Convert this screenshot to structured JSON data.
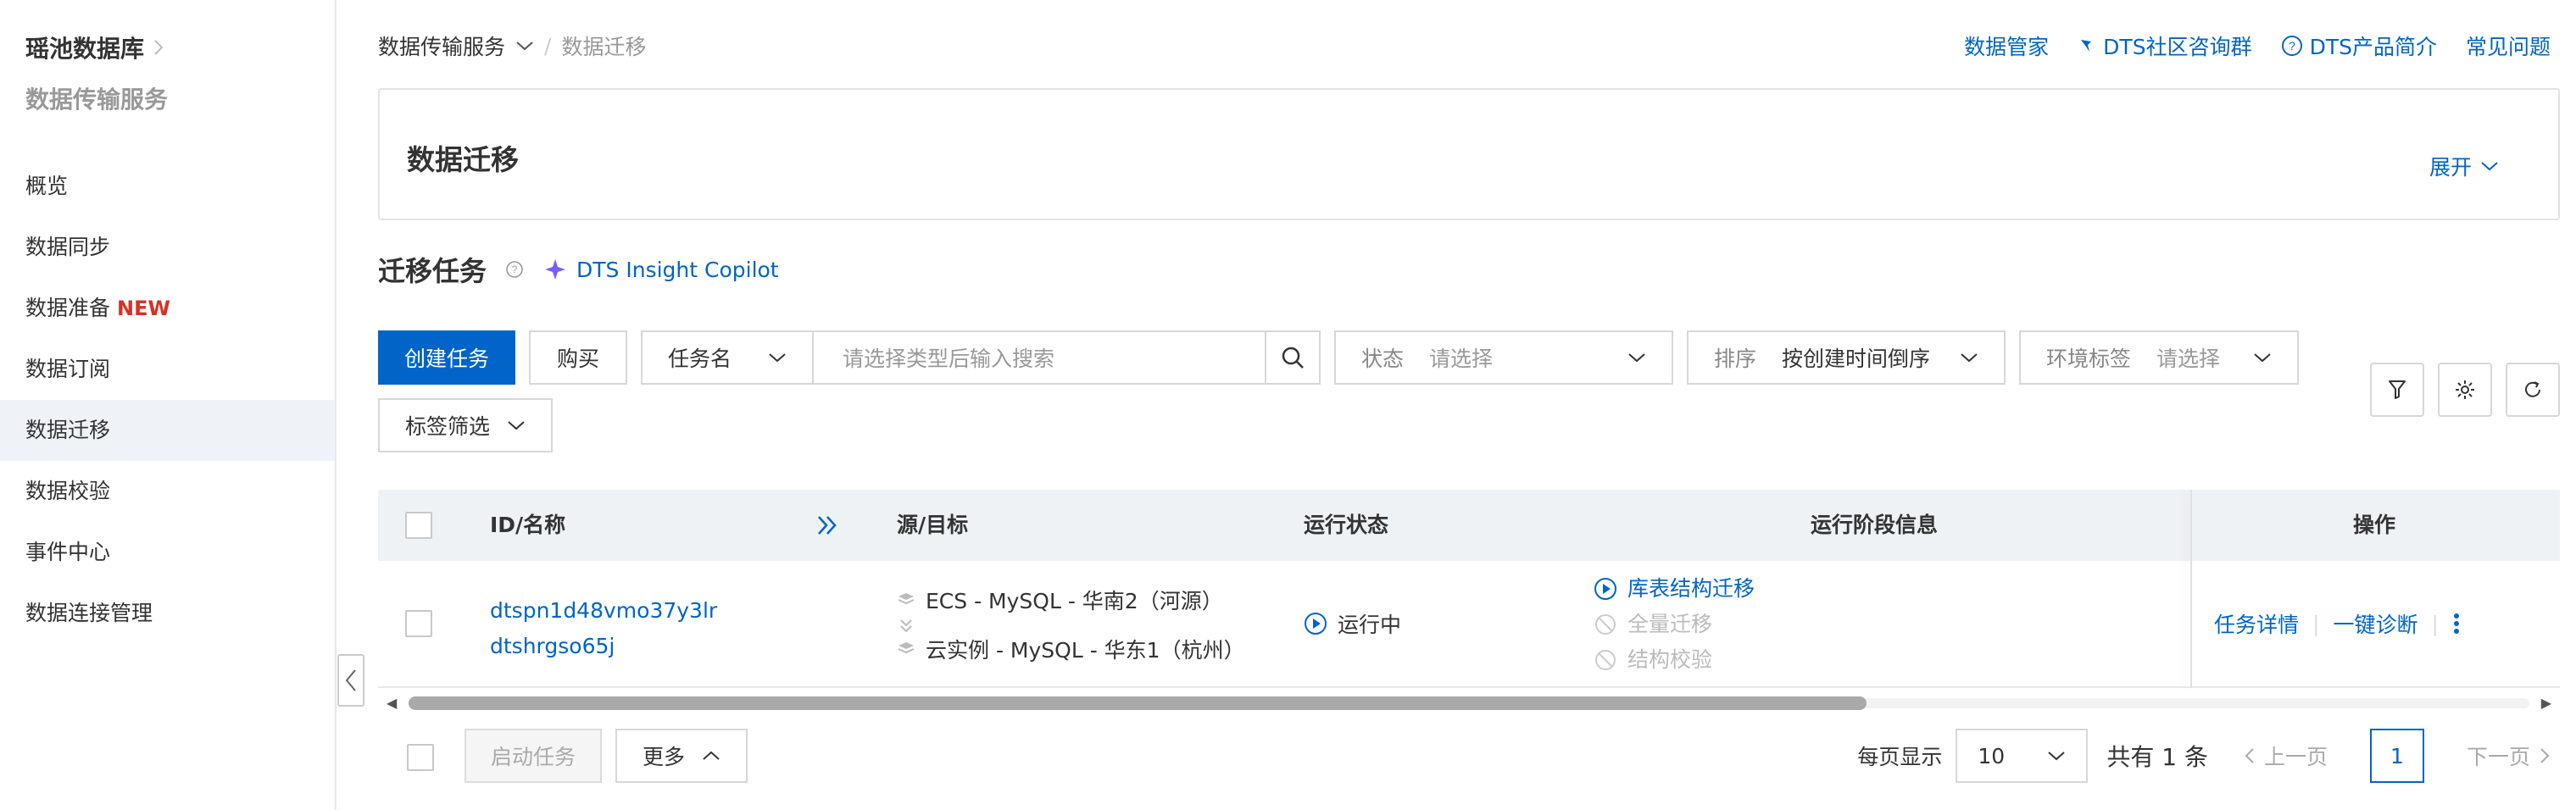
{
  "sidebar": {
    "title1": "瑶池数据库",
    "title2": "数据传输服务",
    "items": [
      {
        "label": "概览"
      },
      {
        "label": "数据同步"
      },
      {
        "label": "数据准备",
        "badge": "NEW"
      },
      {
        "label": "数据订阅"
      },
      {
        "label": "数据迁移",
        "active": true
      },
      {
        "label": "数据校验"
      },
      {
        "label": "事件中心"
      },
      {
        "label": "数据连接管理"
      }
    ]
  },
  "breadcrumb": {
    "parent": "数据传输服务",
    "current": "数据迁移"
  },
  "top_links": {
    "manager": "数据管家",
    "community": "DTS社区咨询群",
    "intro": "DTS产品简介",
    "faq": "常见问题"
  },
  "panel": {
    "title": "数据迁移",
    "expand": "展开"
  },
  "section": {
    "title": "迁移任务",
    "copilot": "DTS Insight Copilot"
  },
  "toolbar": {
    "create": "创建任务",
    "buy": "购买",
    "name_select": "任务名",
    "search_placeholder": "请选择类型后输入搜索",
    "status_label": "状态",
    "status_value": "请选择",
    "sort_label": "排序",
    "sort_value": "按创建时间倒序",
    "env_label": "环境标签",
    "env_value": "请选择",
    "tag_filter": "标签筛选"
  },
  "table": {
    "headers": {
      "id": "ID/名称",
      "src": "源/目标",
      "status": "运行状态",
      "phase": "运行阶段信息",
      "op": "操作"
    },
    "rows": [
      {
        "id": "dtspn1d48vmo37y3lr",
        "name": "dtshrgso65j",
        "source": "ECS - MySQL - 华南2（河源）",
        "target": "云实例 - MySQL - 华东1（杭州）",
        "status": "运行中",
        "phases": [
          "库表结构迁移",
          "全量迁移",
          "结构校验"
        ],
        "actions": [
          "任务详情",
          "一键诊断"
        ]
      }
    ]
  },
  "footer": {
    "start": "启动任务",
    "more": "更多",
    "page_size_label": "每页显示",
    "page_size": "10",
    "total": "共有 1 条",
    "prev": "上一页",
    "page": "1",
    "next": "下一页"
  },
  "colors": {
    "accent": "#0064c8",
    "new_badge": "#d93026"
  }
}
